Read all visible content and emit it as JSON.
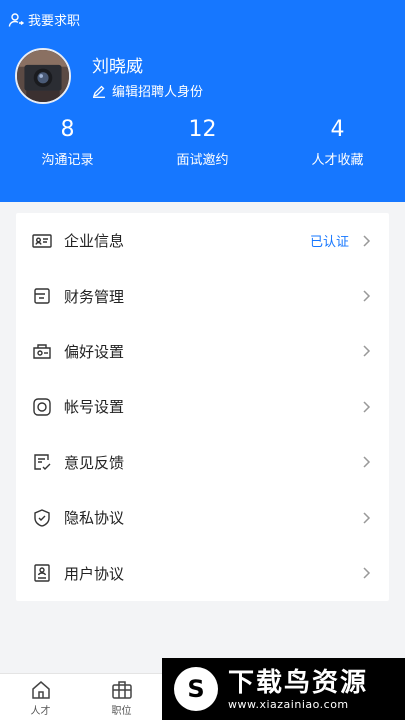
{
  "header": {
    "switch_role_label": "我要求职",
    "user_name": "刘晓威",
    "edit_identity_label": "编辑招聘人身份",
    "stats": [
      {
        "value": "8",
        "label": "沟通记录"
      },
      {
        "value": "12",
        "label": "面试邀约"
      },
      {
        "value": "4",
        "label": "人才收藏"
      }
    ]
  },
  "menu": {
    "items": [
      {
        "label": "企业信息",
        "status": "已认证",
        "icon": "id-card-icon"
      },
      {
        "label": "财务管理",
        "status": "",
        "icon": "wallet-icon"
      },
      {
        "label": "偏好设置",
        "status": "",
        "icon": "preference-icon"
      },
      {
        "label": "帐号设置",
        "status": "",
        "icon": "account-icon"
      },
      {
        "label": "意见反馈",
        "status": "",
        "icon": "feedback-icon"
      },
      {
        "label": "隐私协议",
        "status": "",
        "icon": "shield-icon"
      },
      {
        "label": "用户协议",
        "status": "",
        "icon": "document-icon"
      }
    ]
  },
  "tabbar": {
    "tabs": [
      {
        "label": "人才",
        "icon": "home-icon"
      },
      {
        "label": "职位",
        "icon": "briefcase-icon"
      }
    ]
  },
  "watermark": {
    "logo_char": "S",
    "title": "下载鸟资源",
    "url": "www.xiazainiao.com"
  },
  "colors": {
    "brand": "#1677ff",
    "background": "#f3f4f6"
  }
}
